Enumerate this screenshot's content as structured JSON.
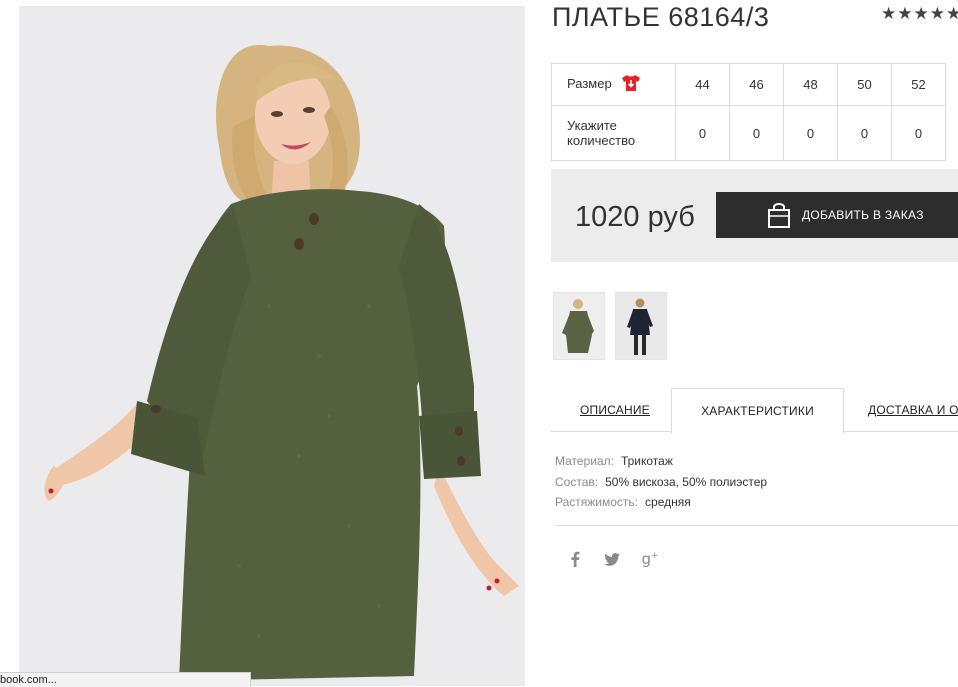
{
  "product": {
    "title": "ПЛАТЬЕ 68164/3",
    "rating_stars": "★★★★★",
    "photo_icon": "model-in-olive-knit-dress-photo"
  },
  "sizes": {
    "size_label": "Размер",
    "size_icon": "tshirt-size-icon",
    "qty_label_line1": "Укажите",
    "qty_label_line2": "количество",
    "values": [
      "44",
      "46",
      "48",
      "50",
      "52"
    ],
    "quantities": [
      "0",
      "0",
      "0",
      "0",
      "0"
    ]
  },
  "purchase": {
    "price": "1020 руб",
    "button_label": "ДОБАВИТЬ В ЗАКАЗ",
    "button_icon": "shopping-bag-icon"
  },
  "thumbnails": [
    {
      "name": "thumbnail-olive-dress",
      "color": "#5b6344"
    },
    {
      "name": "thumbnail-navy-dress",
      "color": "#1f2433"
    }
  ],
  "tabs": [
    "ОПИСАНИЕ",
    "ХАРАКТЕРИСТИКИ",
    "ДОСТАВКА И ОПЛАТА"
  ],
  "specs": [
    {
      "key": "Материал:",
      "value": "Трикотаж"
    },
    {
      "key": "Состав:",
      "value": "50% вискоза, 50% полиэстер"
    },
    {
      "key": "Растяжимость:",
      "value": "средняя"
    }
  ],
  "social": [
    "f",
    "🐦",
    "g+"
  ],
  "status_bar": "book.com...",
  "colors": {
    "dress": "#55603f",
    "button_bg": "#2d2d2d",
    "size_icon_red": "#e8202a"
  }
}
